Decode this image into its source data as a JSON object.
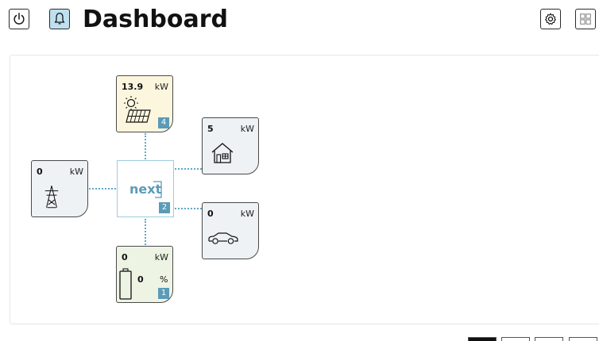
{
  "header": {
    "title": "Dashboard",
    "power_icon": "power-icon",
    "bell_icon": "bell-icon",
    "settings_icon": "gear-icon",
    "layout_icon": "grid-layout-icon"
  },
  "colors": {
    "accent": "#5b9bb8",
    "active_button": "#bfe0ef",
    "solar_card": "#fcf6de",
    "battery_card": "#eef4e4",
    "default_card": "#eef2f5"
  },
  "flow": {
    "hub": {
      "logo_text": "next",
      "badge": "2"
    },
    "solar": {
      "value": "13.9",
      "unit": "kW",
      "badge": "4",
      "icon": "solar-panel-icon"
    },
    "grid": {
      "value": "0",
      "unit": "kW",
      "icon": "power-tower-icon"
    },
    "house": {
      "value": "5",
      "unit": "kW",
      "icon": "house-icon"
    },
    "car": {
      "value": "0",
      "unit": "kW",
      "icon": "car-icon"
    },
    "battery": {
      "value": "0",
      "unit": "kW",
      "soc_value": "0",
      "soc_unit": "%",
      "badge": "1",
      "icon": "battery-icon"
    }
  },
  "pagination": {
    "pages": 4,
    "active_index": 0
  }
}
